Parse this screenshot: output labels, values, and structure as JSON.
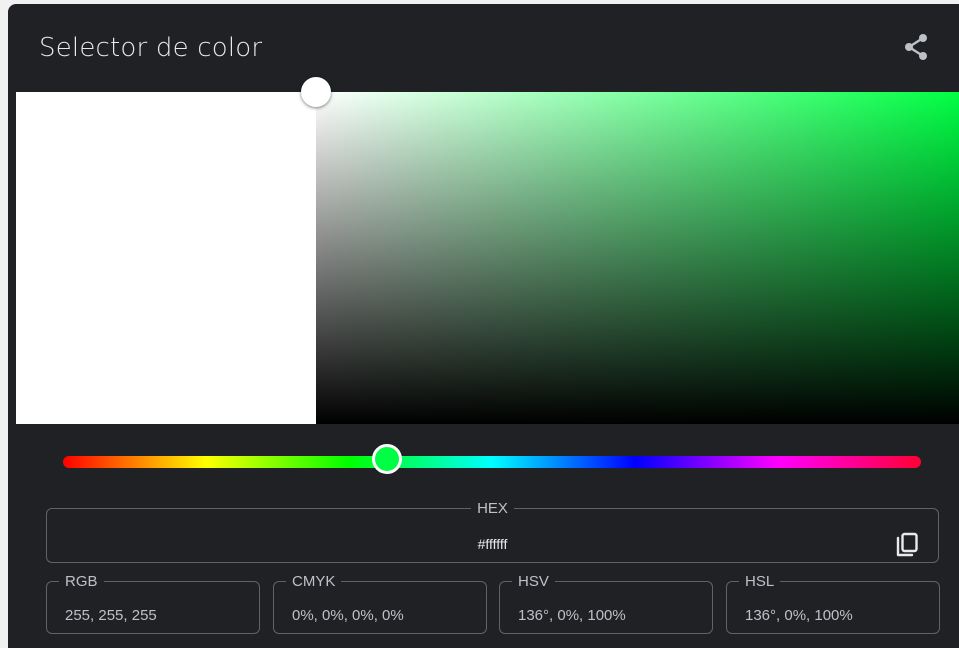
{
  "widget": {
    "title": "Selector de color",
    "icons": {
      "share": "share-icon",
      "copy": "copy-icon"
    }
  },
  "color": {
    "preview_hex": "#ffffff",
    "hue_color": "#00ff44",
    "hue_degrees": 136,
    "saturation_percent": 0,
    "value_percent": 100
  },
  "fields": {
    "hex": {
      "label": "HEX",
      "value": "#ffffff"
    },
    "rgb": {
      "label": "RGB",
      "value": "255, 255, 255"
    },
    "cmyk": {
      "label": "CMYK",
      "value": "0%, 0%, 0%, 0%"
    },
    "hsv": {
      "label": "HSV",
      "value": "136°, 0%, 100%"
    },
    "hsl": {
      "label": "HSL",
      "value": "136°, 0%, 100%"
    }
  },
  "colors": {
    "background": "#202124",
    "text": "#e8eaed",
    "border": "#5f6368"
  }
}
